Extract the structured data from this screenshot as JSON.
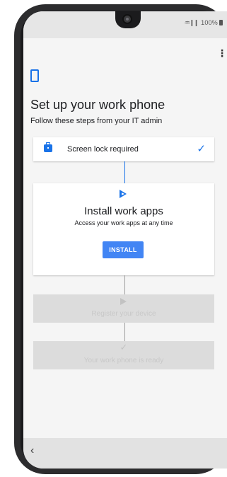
{
  "status_bar": {
    "indicators": "♒∥❙ 100%"
  },
  "menu": {
    "icon": "more-vert-icon",
    "glyph": "⋮"
  },
  "header": {
    "title": "Set up your work phone",
    "subtitle": "Follow these steps from your IT admin"
  },
  "steps": [
    {
      "label": "Screen lock required",
      "state": "completed",
      "icon": "briefcase-icon",
      "status_glyph": "✓"
    },
    {
      "title": "Install work apps",
      "description": "Access your work apps at any time",
      "button_label": "INSTALL",
      "state": "active",
      "icon": "play-icon"
    },
    {
      "label": "Register your device",
      "state": "disabled",
      "icon": "play-icon"
    },
    {
      "label": "Your work phone is ready",
      "state": "disabled",
      "icon": "check-icon",
      "status_glyph": "✓"
    }
  ],
  "nav": {
    "back_glyph": "‹"
  },
  "colors": {
    "accent": "#1a73e8",
    "button": "#4285f4",
    "disabled_card": "#dcdcdc",
    "background": "#f5f5f5"
  }
}
